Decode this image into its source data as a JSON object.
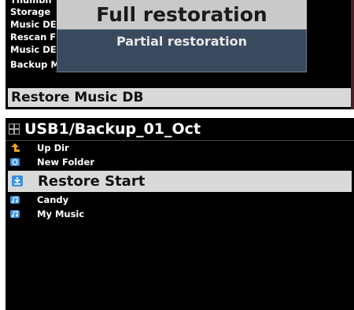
{
  "top_menu": {
    "items": [
      {
        "label": "Thumbn"
      },
      {
        "label": "Storage"
      },
      {
        "label": "Music DE"
      },
      {
        "label": "Rescan F"
      },
      {
        "label": "Music DE"
      },
      {
        "label": "Backup Music DB"
      }
    ],
    "selected_label": "Restore Music DB"
  },
  "popup": {
    "full_restoration": "Full restoration",
    "partial_restoration": "Partial restoration"
  },
  "browser": {
    "path": "USB1/Backup_01_Oct",
    "items": [
      {
        "label": "Up Dir",
        "icon": "up-arrow-icon"
      },
      {
        "label": "New Folder",
        "icon": "new-folder-icon"
      },
      {
        "label": "Restore Start",
        "icon": "download-icon"
      },
      {
        "label": "Candy",
        "icon": "music-folder-icon"
      },
      {
        "label": "My Music",
        "icon": "music-folder-icon"
      }
    ]
  },
  "colors": {
    "background": "#000000",
    "selection": "#d9d9d9",
    "popup_bottom": "#3a4a5e",
    "icon_blue": "#3b8fe0",
    "icon_orange": "#f0a020"
  }
}
